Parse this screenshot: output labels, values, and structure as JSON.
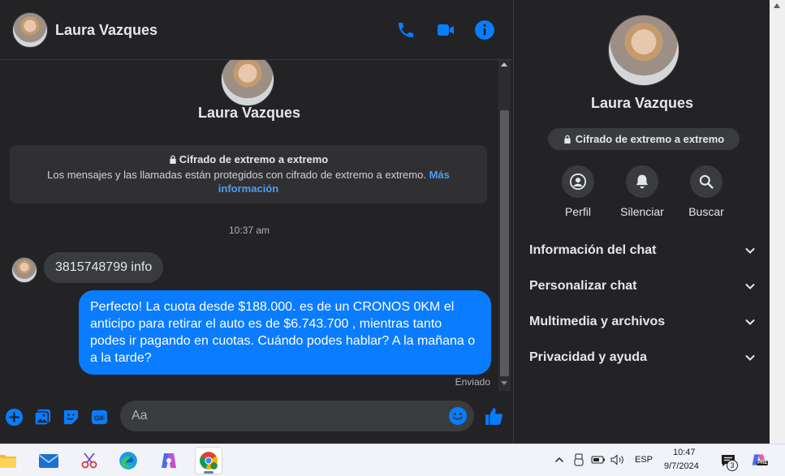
{
  "contact": {
    "name": "Laura Vazques"
  },
  "encryption": {
    "title": "Cifrado de extremo a extremo",
    "description": "Los mensajes y las llamadas están protegidos con cifrado de extremo a extremo.",
    "link": "Más información"
  },
  "messages": {
    "timestamp": "10:37 am",
    "incoming": "3815748799  info",
    "outgoing": "Perfecto! La cuota desde $188.000. es de un CRONOS 0KM el anticipo para retirar el auto es de $6.743.700 , mientras tanto podes ir pagando en cuotas. Cuándo podes hablar? A la mañana o a la tarde?",
    "status": "Enviado"
  },
  "composer": {
    "placeholder": "Aa"
  },
  "info_panel": {
    "name": "Laura Vazques",
    "badge": "Cifrado de extremo a extremo",
    "actions": {
      "profile": "Perfil",
      "mute": "Silenciar",
      "search": "Buscar"
    },
    "sections": {
      "chat_info": "Información del chat",
      "customize": "Personalizar chat",
      "media": "Multimedia y archivos",
      "privacy": "Privacidad y ayuda"
    }
  },
  "taskbar": {
    "language": "ESP",
    "time": "10:47",
    "date": "9/7/2024",
    "notification_count": "3",
    "copilot_badge": "PRE"
  },
  "colors": {
    "accent": "#0a7cff",
    "background": "#232326",
    "bubble_in": "#3a3b3d"
  }
}
